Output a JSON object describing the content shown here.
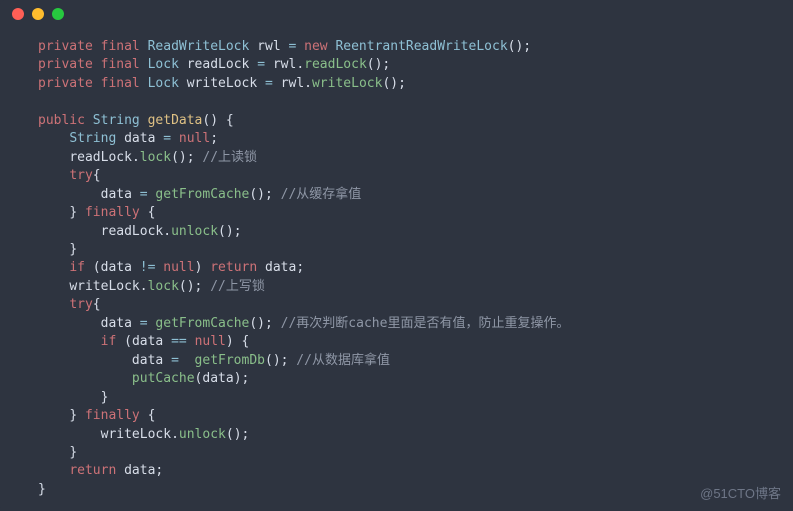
{
  "titlebar": {
    "dots": [
      "red",
      "yellow",
      "green"
    ]
  },
  "code": {
    "l1": {
      "kw1": "private",
      "kw2": "final",
      "type": "ReadWriteLock",
      "var": "rwl",
      "op": "=",
      "kw3": "new",
      "ctor": "ReentrantReadWriteLock",
      "end": "();"
    },
    "l2": {
      "kw1": "private",
      "kw2": "final",
      "type": "Lock",
      "var": "readLock",
      "op": "=",
      "obj": "rwl",
      "dot": ".",
      "call": "readLock",
      "end": "();"
    },
    "l3": {
      "kw1": "private",
      "kw2": "final",
      "type": "Lock",
      "var": "writeLock",
      "op": "=",
      "obj": "rwl",
      "dot": ".",
      "call": "writeLock",
      "end": "();"
    },
    "l5": {
      "kw1": "public",
      "type": "String",
      "fn": "getData",
      "sig": "() {"
    },
    "l6": {
      "type": "String",
      "var": "data",
      "op": "=",
      "lit": "null",
      "end": ";"
    },
    "l7": {
      "obj": "readLock",
      "dot": ".",
      "call": "lock",
      "end": "();",
      "cmnt": " //上读锁"
    },
    "l8": {
      "kw": "try",
      "brace": "{"
    },
    "l9": {
      "var": "data",
      "op": "=",
      "call": "getFromCache",
      "end": "();",
      "cmnt": " //从缓存拿值"
    },
    "l10": {
      "brace": "}",
      "kw": "finally",
      "brace2": " {"
    },
    "l11": {
      "obj": "readLock",
      "dot": ".",
      "call": "unlock",
      "end": "();"
    },
    "l12": {
      "brace": "}"
    },
    "l13": {
      "kw1": "if",
      "open": " (",
      "var": "data",
      "op": "!=",
      "lit": "null",
      "close": ") ",
      "kw2": "return",
      "var2": " data",
      "end": ";"
    },
    "l14": {
      "obj": "writeLock",
      "dot": ".",
      "call": "lock",
      "end": "();",
      "cmnt": " //上写锁"
    },
    "l15": {
      "kw": "try",
      "brace": "{"
    },
    "l16": {
      "var": "data",
      "op": "=",
      "call": "getFromCache",
      "end": "();",
      "cmnt": " //再次判断cache里面是否有值，防止重复操作。"
    },
    "l17": {
      "kw": "if",
      "open": " (",
      "var": "data",
      "op": "==",
      "lit": "null",
      "close": ") {"
    },
    "l18": {
      "var": "data",
      "op": "=",
      "call": "getFromDb",
      "end": "();",
      "cmnt": " //从数据库拿值"
    },
    "l19": {
      "call": "putCache",
      "open": "(",
      "arg": "data",
      "close": ");"
    },
    "l20": {
      "brace": "}"
    },
    "l21": {
      "brace": "}",
      "kw": "finally",
      "brace2": " {"
    },
    "l22": {
      "obj": "writeLock",
      "dot": ".",
      "call": "unlock",
      "end": "();"
    },
    "l23": {
      "brace": "}"
    },
    "l24": {
      "kw": "return",
      "var": " data",
      "end": ";"
    },
    "l25": {
      "brace": "}"
    }
  },
  "watermark": "@51CTO博客"
}
